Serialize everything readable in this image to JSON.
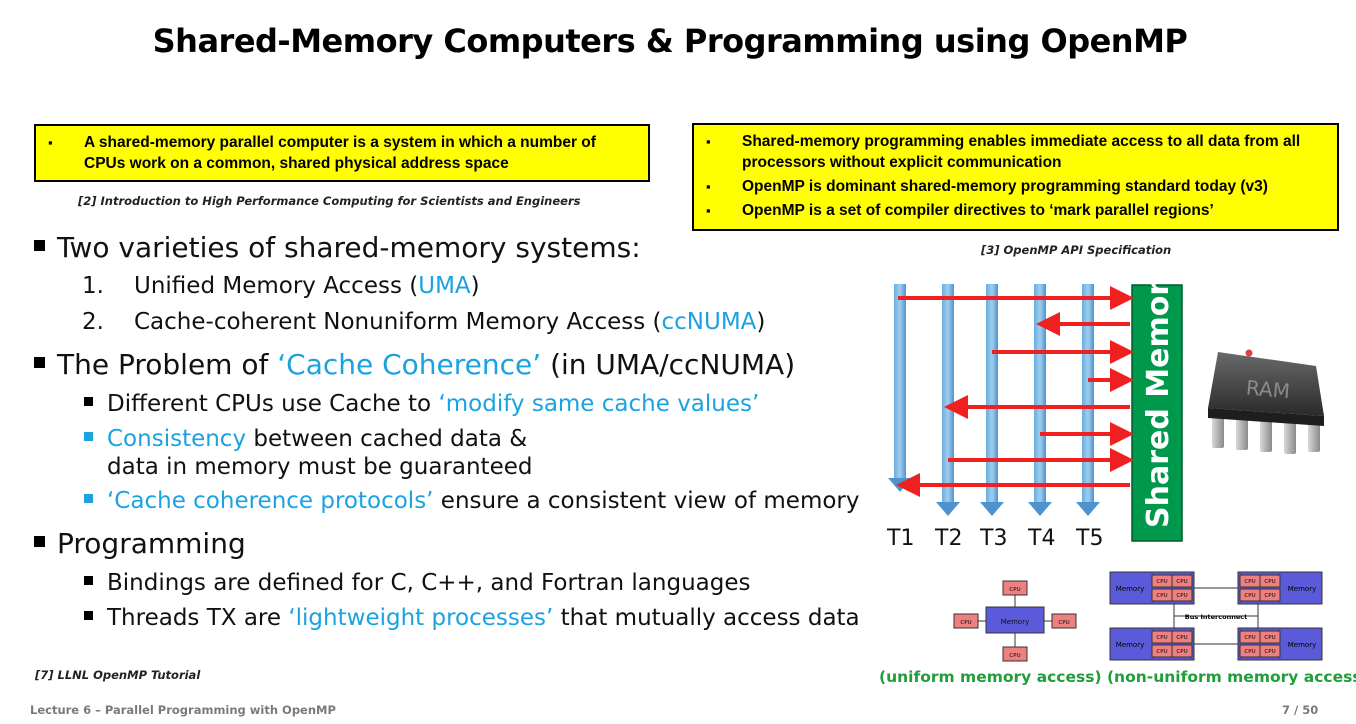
{
  "slide": {
    "title": "Shared-Memory Computers & Programming using OpenMP",
    "box_left": {
      "items": [
        "A shared-memory parallel computer is a system in which a number of CPUs work on a common, shared physical address space"
      ]
    },
    "ref_left": "[2] Introduction to High Performance Computing for Scientists and Engineers",
    "box_right": {
      "items": [
        "Shared-memory programming enables immediate access to all data from all processors without explicit communication",
        "OpenMP is dominant shared-memory programming standard today (v3)",
        "OpenMP is a set of compiler directives to ‘mark parallel regions’"
      ]
    },
    "ref_right": "[3] OpenMP API Specification",
    "bullets": {
      "varieties": "Two varieties of shared-memory systems:",
      "item1_num": "1.",
      "item1_text": "Unified Memory Access (",
      "item1_hl": "UMA",
      "item1_end": ")",
      "item2_num": "2.",
      "item2_text": "Cache-coherent Nonuniform Memory Access (",
      "item2_hl": "ccNUMA",
      "item2_end": ")",
      "problem_pre": "The Problem of ",
      "problem_hl": "‘Cache Coherence’",
      "problem_post": " (in UMA/ccNUMA)",
      "cache_pre": "Different CPUs use Cache to ",
      "cache_hl": "‘modify same cache values’",
      "consistency_hl": "Consistency",
      "consistency_post": " between cached data &",
      "consistency_line2": "data in memory must be guaranteed",
      "protocols_hl": "‘Cache coherence protocols’",
      "protocols_post": " ensure a consistent view of memory",
      "programming": "Programming",
      "bindings": "Bindings are defined for C, C++, and Fortran languages",
      "threads_pre": "Threads TX are ",
      "threads_hl": "‘lightweight processes’",
      "threads_post": " that mutually access data"
    },
    "ref_bottom": "[7] LLNL OpenMP Tutorial",
    "diagram": {
      "shared_memory": "Shared Memory",
      "threads": [
        "T1",
        "T2",
        "T3",
        "T4",
        "T5"
      ],
      "ram_label": "RAM",
      "uma": {
        "center": "Memory",
        "cpu": "CPU"
      },
      "numa": {
        "memory": "Memory",
        "cpu": "CPU",
        "bus": "Bus Interconnect"
      },
      "caption_uma": "(uniform memory access)",
      "caption_numa": "(non-uniform memory access)"
    },
    "footer_left": "Lecture 6 – Parallel Programming with OpenMP",
    "footer_right": "7 / 50"
  }
}
